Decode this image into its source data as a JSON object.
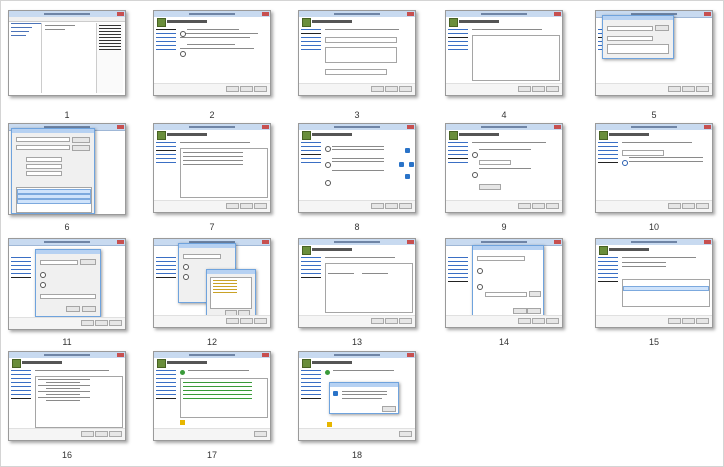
{
  "captions": [
    "1",
    "2",
    "3",
    "4",
    "5",
    "6",
    "7",
    "8",
    "9",
    "10",
    "11",
    "12",
    "13",
    "14",
    "15",
    "16",
    "17",
    "18"
  ],
  "colors": {
    "title_bar": "#c8daf0",
    "nav_link": "#3a6fc4",
    "dialog_border": "#6fa3dd",
    "wizard_icon": "#6a8e3b"
  },
  "icons": [
    "wizard-icon",
    "close-icon",
    "topology-icon",
    "warning-icon",
    "success-icon"
  ]
}
